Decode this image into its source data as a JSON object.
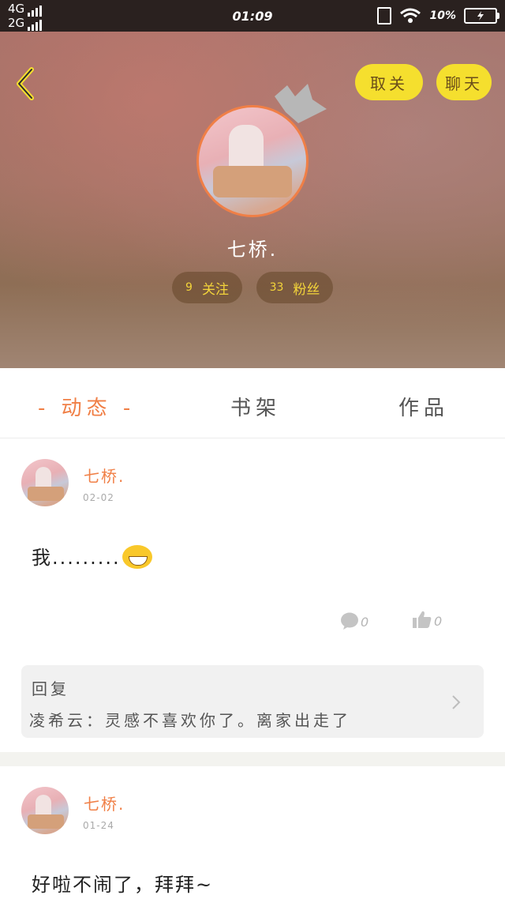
{
  "status_bar": {
    "network_1": "4G",
    "network_2": "2G",
    "time": "01:09",
    "wifi_percent": "10"
  },
  "header": {
    "unfollow_label": "取关",
    "chat_label": "聊天",
    "username": "七桥.",
    "following_count": "9",
    "following_label": "关注",
    "fans_count": "33",
    "fans_label": "粉丝"
  },
  "tabs": [
    {
      "label": "- 动态 -",
      "active": true
    },
    {
      "label": "书架",
      "active": false
    },
    {
      "label": "作品",
      "active": false
    }
  ],
  "posts": [
    {
      "name": "七桥.",
      "date": "02-02",
      "text": "我.........",
      "emoji": "grinning-face",
      "comments": "0",
      "likes": "0",
      "reply": {
        "title": "回复",
        "body": "凌希云：灵感不喜欢你了。离家出走了"
      }
    },
    {
      "name": "七桥.",
      "date": "01-24",
      "text": "好啦不闹了，拜拜~"
    }
  ],
  "colors": {
    "accent": "#f07f46",
    "pill_yellow": "#f5df2e",
    "stat_text": "#f3d43a"
  }
}
